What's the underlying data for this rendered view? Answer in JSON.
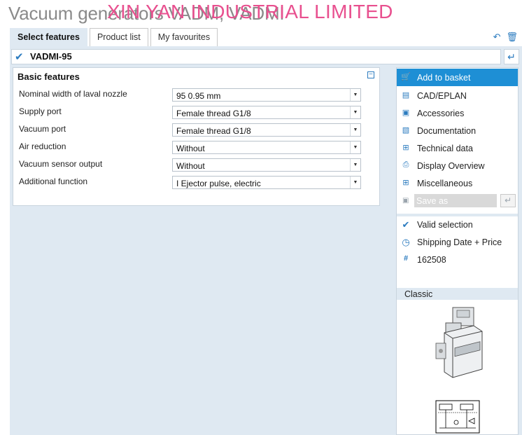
{
  "header": {
    "title": "Vacuum generators VADM, VADMI",
    "watermark": "XIN YAN INDUSTRIAL LIMITED"
  },
  "tabs": [
    {
      "label": "Select features",
      "active": true
    },
    {
      "label": "Product list",
      "active": false
    },
    {
      "label": "My favourites",
      "active": false
    }
  ],
  "tab_icons": [
    "share-icon",
    "trash-icon"
  ],
  "config": {
    "name": "VADMI-95"
  },
  "features_panel": {
    "title": "Basic features",
    "rows": [
      {
        "label": "Nominal width of laval nozzle",
        "value": "95 0.95 mm"
      },
      {
        "label": "Supply port",
        "value": "Female thread G1/8"
      },
      {
        "label": "Vacuum port",
        "value": "Female thread G1/8"
      },
      {
        "label": "Air reduction",
        "value": "Without"
      },
      {
        "label": "Vacuum sensor output",
        "value": "Without"
      },
      {
        "label": "Additional function",
        "value": "I Ejector pulse, electric"
      }
    ]
  },
  "side_panel": {
    "actions": [
      {
        "label": "Add to basket",
        "icon": "basket-icon"
      },
      {
        "label": "CAD/EPLAN",
        "icon": "cad-icon"
      },
      {
        "label": "Accessories",
        "icon": "accessories-icon"
      },
      {
        "label": "Documentation",
        "icon": "pdf-icon"
      },
      {
        "label": "Technical data",
        "icon": "table-icon"
      },
      {
        "label": "Display Overview",
        "icon": "printer-icon"
      },
      {
        "label": "Miscellaneous",
        "icon": "plus-box-icon"
      }
    ],
    "save_as_label": "Save as",
    "status": [
      {
        "label": "Valid selection",
        "icon": "check-icon"
      },
      {
        "label": "Shipping Date + Price",
        "icon": "clock-icon"
      },
      {
        "label": "162508",
        "icon": "hash-icon"
      }
    ],
    "image_section_label": "Classic"
  },
  "colors": {
    "accent": "#1e8fd5",
    "panel_bg": "#dfe9f2",
    "watermark": "#e8508f"
  }
}
